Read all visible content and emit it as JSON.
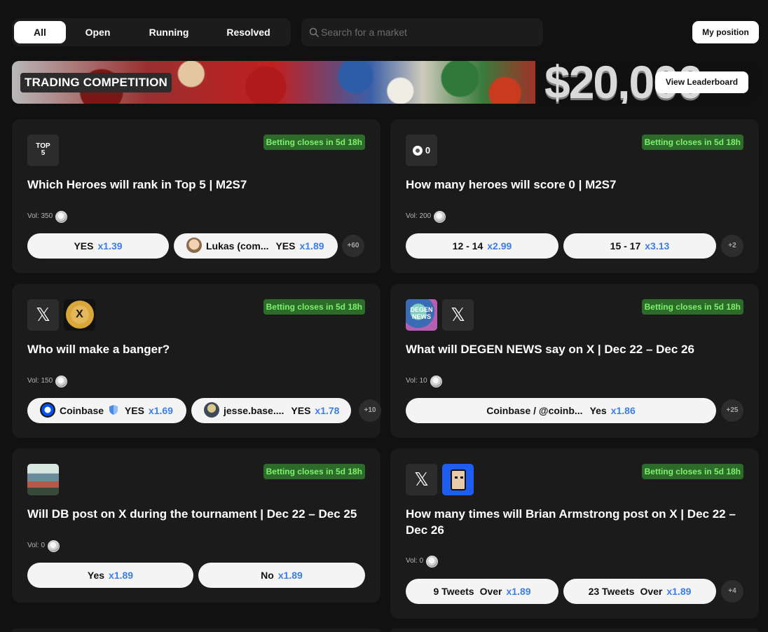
{
  "filters": [
    "All",
    "Open",
    "Running",
    "Resolved"
  ],
  "search": {
    "placeholder": "Search for a market"
  },
  "my_position": "My position",
  "banner": {
    "title": "TRADING COMPETITION",
    "prize": "$20,000",
    "leaderboard": "View Leaderboard"
  },
  "cards": [
    {
      "icon_text": "TOP 5",
      "badge": "Betting closes in 5d 18h",
      "title": "Which Heroes will rank in Top 5 | M2S7",
      "vol": "Vol: 350",
      "opts": [
        {
          "label": "YES",
          "mult": "x1.39"
        },
        {
          "label": "Lukas (com...",
          "side": "YES",
          "mult": "x1.89"
        }
      ],
      "more": "+60"
    },
    {
      "icon_text": "0",
      "badge": "Betting closes in 5d 18h",
      "title": "How many heroes will score 0 | M2S7",
      "vol": "Vol: 200",
      "opts": [
        {
          "label": "12 - 14",
          "mult": "x2.99"
        },
        {
          "label": "15 - 17",
          "mult": "x3.13"
        }
      ],
      "more": "+2"
    },
    {
      "badge": "Betting closes in 5d 18h",
      "title": "Who will make a banger?",
      "vol": "Vol: 150",
      "opts": [
        {
          "label": "Coinbase",
          "side": "YES",
          "mult": "x1.69"
        },
        {
          "label": "jesse.base....",
          "side": "YES",
          "mult": "x1.78"
        }
      ],
      "more": "+10"
    },
    {
      "icon_text": "DEGEN NEWS",
      "badge": "Betting closes in 5d 18h",
      "title": "What will DEGEN NEWS say on X | Dec 22 – Dec 26",
      "vol": "Vol: 10",
      "opts": [
        {
          "label": "Coinbase / @coinb...",
          "side": "Yes",
          "mult": "x1.86"
        }
      ],
      "more": "+25"
    },
    {
      "badge": "Betting closes in 5d 18h",
      "title": "Will DB post on X during the tournament | Dec 22 – Dec 25",
      "vol": "Vol: 0",
      "opts": [
        {
          "label": "Yes",
          "mult": "x1.89"
        },
        {
          "label": "No",
          "mult": "x1.89"
        }
      ]
    },
    {
      "badge": "Betting closes in 5d 18h",
      "title": "How many times will Brian Armstrong post on X | Dec 22 – Dec 26",
      "vol": "Vol: 0",
      "opts": [
        {
          "label": "9 Tweets",
          "side": "Over",
          "mult": "x1.89"
        },
        {
          "label": "23 Tweets",
          "side": "Over",
          "mult": "x1.89"
        }
      ],
      "more": "+4"
    }
  ],
  "colors": {
    "background": "#111111",
    "card": "#1b1b1b",
    "badge_bg": "#2c6b2a",
    "badge_text": "#7ff06d",
    "multiplier": "#3c7ee6"
  },
  "icons": [
    "search-icon",
    "x-logo-icon",
    "coin-icon",
    "shield-icon",
    "avatar"
  ]
}
